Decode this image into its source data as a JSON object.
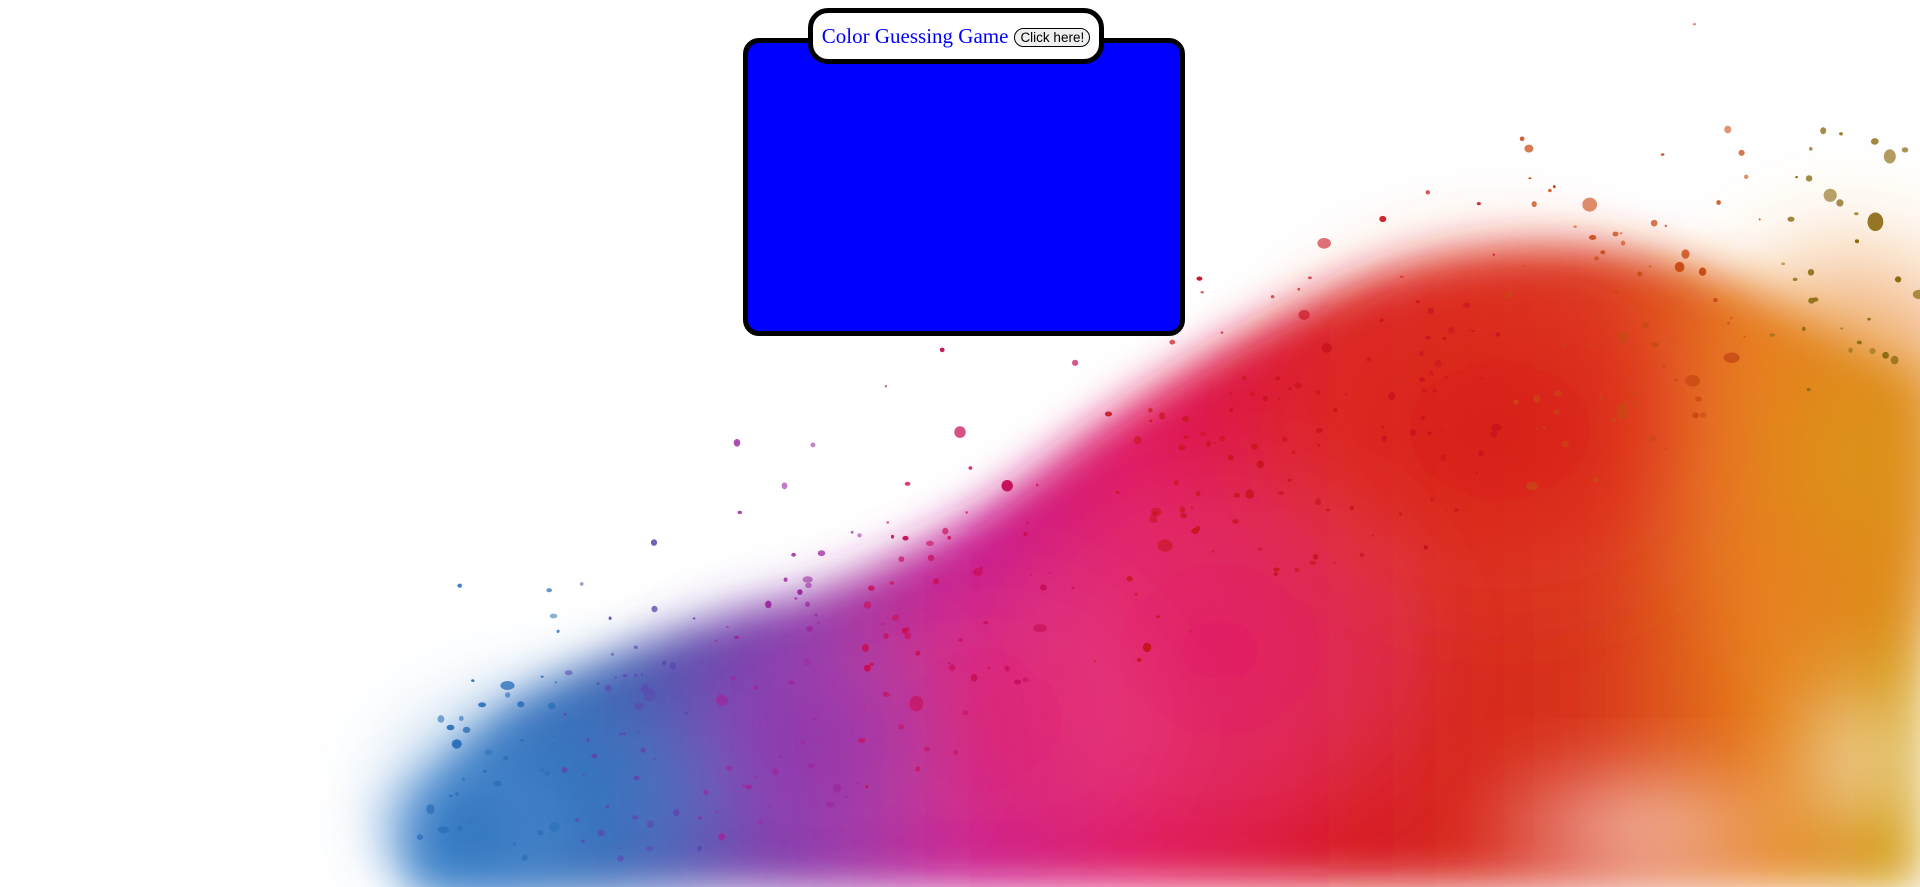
{
  "game": {
    "title": "Color Guessing Game",
    "button_label": "Click here!",
    "box_color": "#0000ff",
    "title_color": "#0000ff"
  },
  "background": {
    "image": "colored-powder-explosion",
    "colors": [
      "#1e73be",
      "#6a3fb0",
      "#b0198f",
      "#e0145a",
      "#d41a1a",
      "#e8741c",
      "#c89a12"
    ]
  }
}
